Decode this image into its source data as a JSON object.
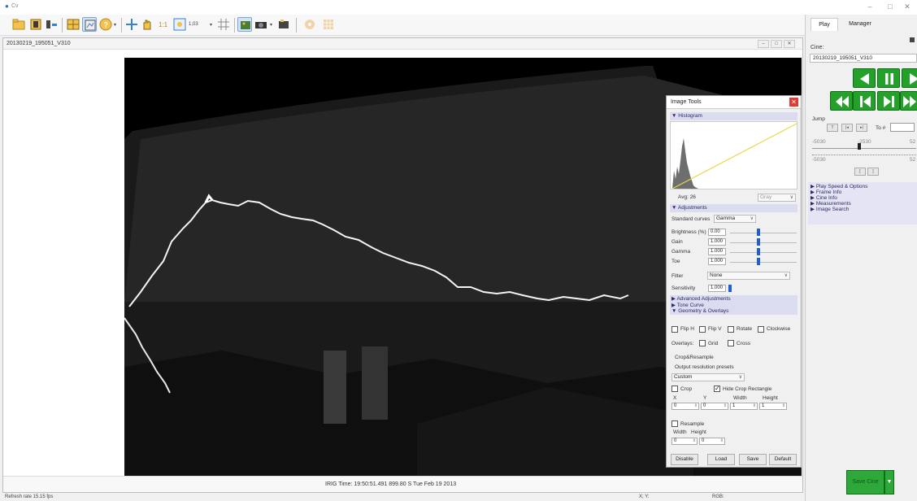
{
  "window": {
    "app_name": "Cv",
    "minimize": "–",
    "maximize": "□",
    "close": "✕"
  },
  "toolbar": {
    "zoom_value": "1,03"
  },
  "document": {
    "title": "20130219_195051_V310",
    "irig_time": "IRIG Time: 19:50:51.491 899.80 S  Tue Feb 19 2013"
  },
  "statusbar": {
    "refresh_rate": "Refresh rate 15.15 fps",
    "xy": "X; Y:",
    "rgb": "RGB:"
  },
  "image_tools": {
    "title": "Image Tools",
    "histogram_section": "Histogram",
    "avg": "Avg: 26",
    "channel": "Gray",
    "adjustments_section": "Adjustments",
    "standard_curves_label": "Standard curves",
    "standard_curves_value": "Gamma",
    "brightness_label": "Brightness (%)",
    "brightness_value": "0.00",
    "gain_label": "Gain",
    "gain_value": "1.000",
    "gamma_label": "Gamma",
    "gamma_value": "1.000",
    "toe_label": "Toe",
    "toe_value": "1.000",
    "filter_label": "Filter",
    "filter_value": "None",
    "sensitivity_label": "Sensitivity",
    "sensitivity_value": "1.000",
    "advanced_adjustments": "Advanced Adjustments",
    "tone_curve": "Tone Curve",
    "geometry_overlays": "Geometry & Overlays",
    "flip_h": "Flip H",
    "flip_v": "Flip V",
    "rotate": "Rotate",
    "clockwise": "Clockwise",
    "overlays_label": "Overlays:",
    "grid": "Grid",
    "cross": "Cross",
    "crop_resample": "Crop&Resample",
    "output_presets": "Output resolution presets",
    "preset_value": "Custom",
    "crop": "Crop",
    "hide_crop": "Hide Crop Rectangle",
    "x_label": "X",
    "y_label": "Y",
    "width_label": "Width",
    "height_label": "Height",
    "crop_x": "0",
    "crop_y": "0",
    "crop_w": "1",
    "crop_h": "1",
    "resample": "Resample",
    "res_width_label": "Width",
    "res_height_label": "Height",
    "res_w": "0",
    "res_h": "0",
    "disable": "Disable",
    "load": "Load",
    "save": "Save",
    "default": "Default"
  },
  "right_panel": {
    "tab_play": "Play",
    "tab_manager": "Manager",
    "cine_label": "Cine:",
    "cine_value": "20130219_195051_V310",
    "jump_label": "Jump",
    "to_label": "To #",
    "slider_min": "-5030",
    "slider_mid": "-2530",
    "slider_max": "52",
    "slider_min2": "-5030",
    "slider_max2": "52",
    "tree": [
      "Play Speed & Options",
      "Frame Info",
      "Cine Info",
      "Measurements",
      "Image Search"
    ],
    "save_cine": "Save Cine"
  },
  "colors": {
    "play_green": "#24a12a",
    "close_red": "#e03c31",
    "slider_blue": "#1f5fd6",
    "section_lavender": "#dcdcf0"
  }
}
